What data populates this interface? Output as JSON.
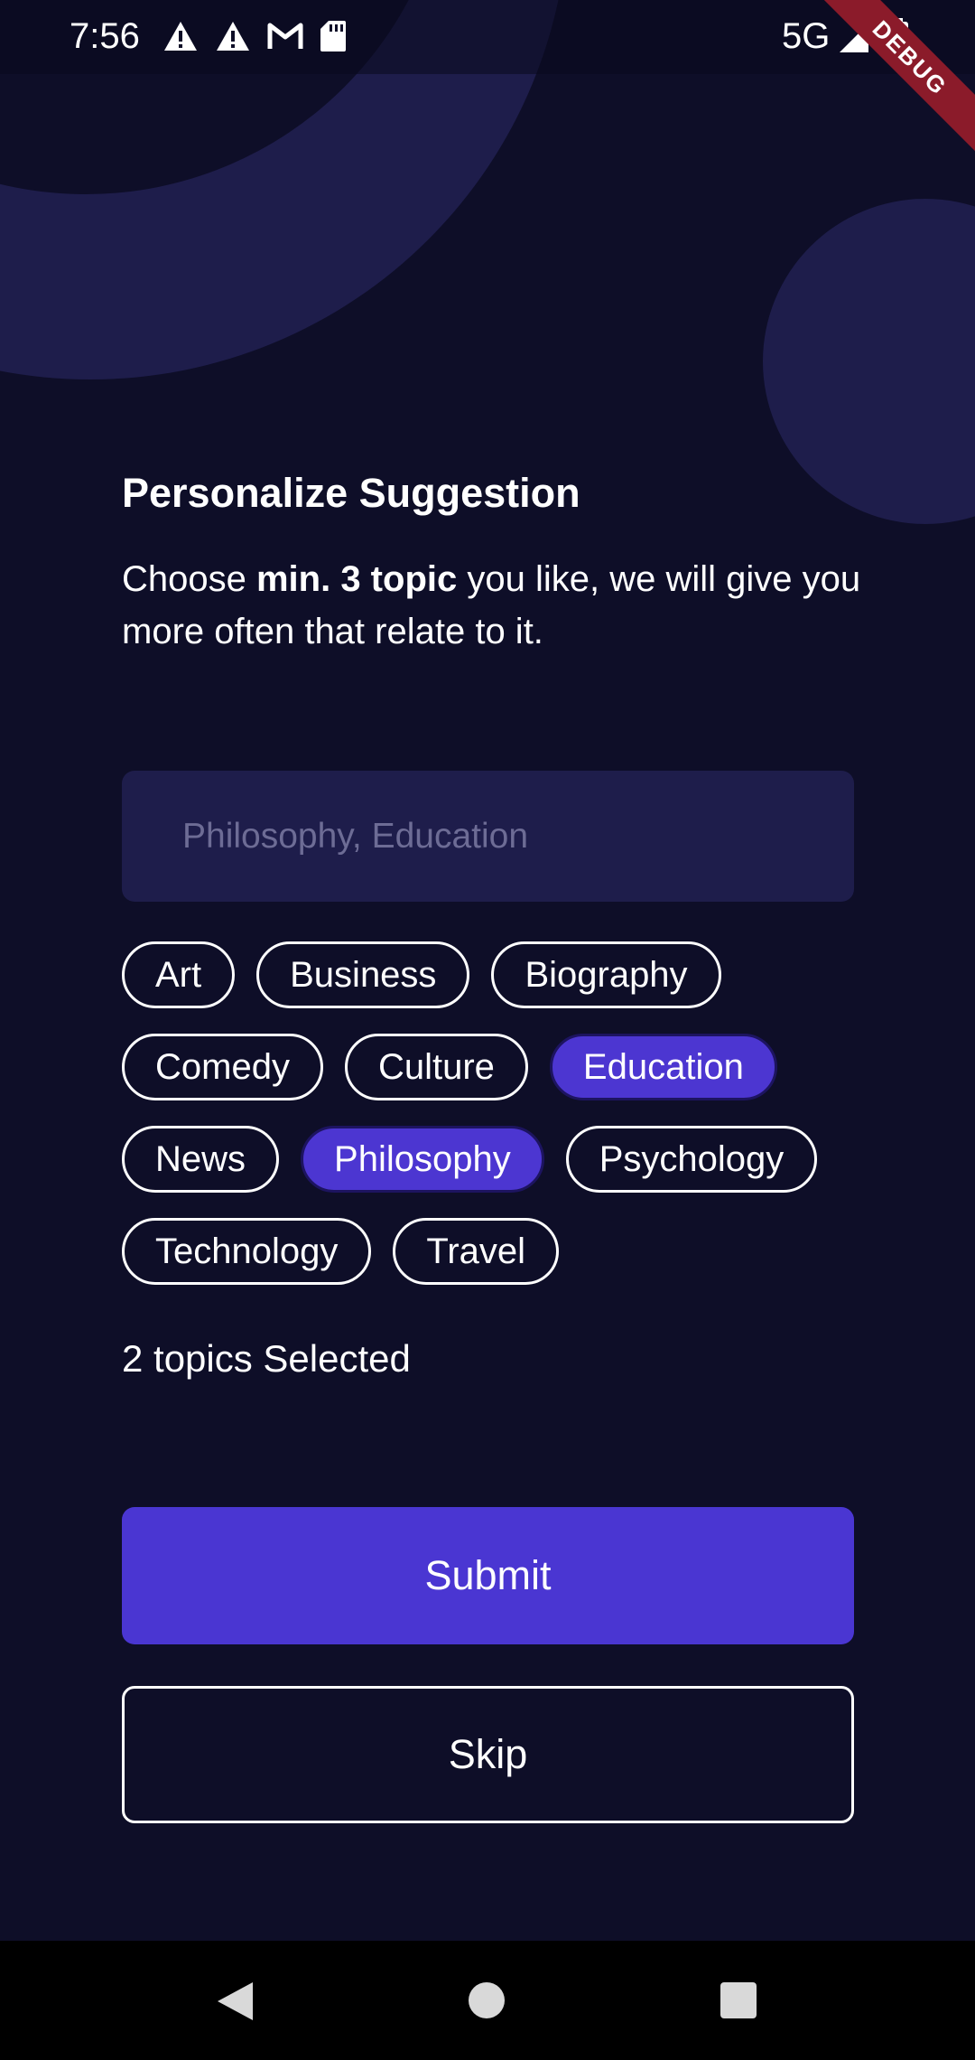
{
  "status_bar": {
    "time": "7:56",
    "network": "5G",
    "debug_label": "DEBUG",
    "icons": [
      "warning-icon",
      "warning-icon",
      "gmail-icon",
      "sd-card-icon",
      "signal-icon",
      "battery-icon"
    ]
  },
  "header": {
    "title": "Personalize Suggestion",
    "subtitle_prefix": "Choose ",
    "subtitle_bold": "min. 3 topic",
    "subtitle_suffix": " you like, we will give you more often that relate to it."
  },
  "search": {
    "placeholder": "Philosophy, Education"
  },
  "topics": [
    {
      "label": "Art",
      "selected": false
    },
    {
      "label": "Business",
      "selected": false
    },
    {
      "label": "Biography",
      "selected": false
    },
    {
      "label": "Comedy",
      "selected": false
    },
    {
      "label": "Culture",
      "selected": false
    },
    {
      "label": "Education",
      "selected": true
    },
    {
      "label": "News",
      "selected": false
    },
    {
      "label": "Philosophy",
      "selected": true
    },
    {
      "label": "Psychology",
      "selected": false
    },
    {
      "label": "Technology",
      "selected": false
    },
    {
      "label": "Travel",
      "selected": false
    }
  ],
  "selection_count_text": "2 topics Selected",
  "actions": {
    "submit_label": "Submit",
    "skip_label": "Skip"
  },
  "colors": {
    "background": "#0e0e28",
    "accent": "#4a36d2",
    "surface": "#1e1d4b",
    "debug_ribbon": "#8b1b2a"
  }
}
